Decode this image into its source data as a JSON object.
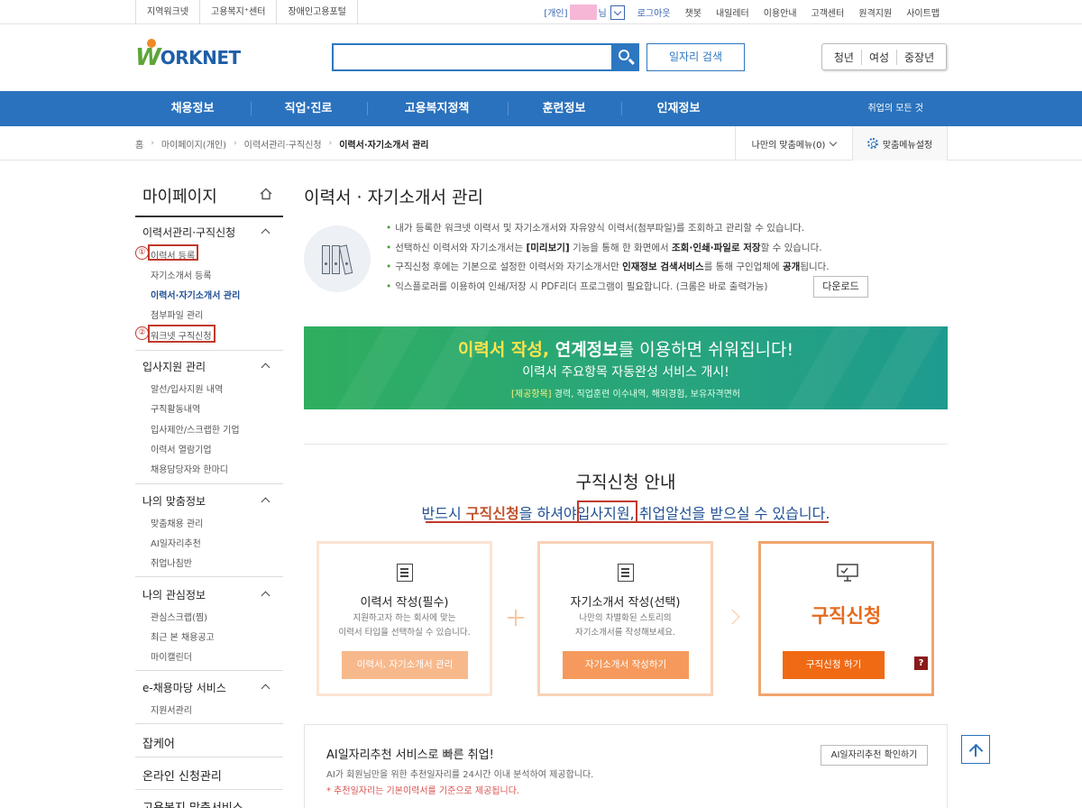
{
  "util": {
    "left_links": [
      "지역워크넷",
      "고용복지⁺센터",
      "장애인고용포털"
    ],
    "user_prefix": "[개인]",
    "user_suffix": "님",
    "right_links": [
      "로그아웃",
      "챗봇",
      "내일레터",
      "이용안내",
      "고객센터",
      "원격지원",
      "사이트맵"
    ]
  },
  "header": {
    "logo_w": "W",
    "logo_rest": "ORKNET",
    "search_placeholder": "",
    "job_search_label": "일자리 검색",
    "target_links": [
      "청년",
      "여성",
      "중장년"
    ]
  },
  "gnb": {
    "items": [
      "채용정보",
      "직업·진로",
      "고용복지정책",
      "훈련정보",
      "인재정보"
    ],
    "right_text": "취업의 모든 것"
  },
  "breadcrumb": {
    "items": [
      "홈",
      "마이페이지(개인)",
      "이력서관리·구직신청",
      "이력서·자기소개서 관리"
    ],
    "my_menu": "나만의 맞춤메뉴(0)",
    "my_setting": "맞춤메뉴설정"
  },
  "sidebar": {
    "title": "마이페이지",
    "sections": [
      {
        "label": "이력서관리·구직신청",
        "items": [
          "이력서 등록",
          "자기소개서 등록",
          "이력서·자기소개서 관리",
          "첨부파일 관리",
          "워크넷 구직신청"
        ]
      },
      {
        "label": "입사지원 관리",
        "items": [
          "알선/입사지원 내역",
          "구직활동내역",
          "입사제안/스크랩한 기업",
          "이력서 열람기업",
          "채용담당자와 한마디"
        ]
      },
      {
        "label": "나의 맞춤정보",
        "items": [
          "맞춤채용 관리",
          "AI일자리추천",
          "취업나침반"
        ]
      },
      {
        "label": "나의 관심정보",
        "items": [
          "관심스크랩(찜)",
          "최근 본 채용공고",
          "마이캘린더"
        ]
      },
      {
        "label": "e-채용마당 서비스",
        "items": [
          "지원서관리"
        ]
      }
    ],
    "extra": [
      "잡케어",
      "온라인 신청관리",
      "고용복지 맞춤서비스"
    ],
    "markers": [
      "①",
      "②"
    ]
  },
  "main": {
    "title": "이력서 · 자기소개서 관리",
    "info": [
      "내가 등록한 워크넷 이력서 및 자기소개서와 자유양식 이력서(첨부파일)를 조회하고 관리할 수 있습니다.",
      {
        "a": "선택하신 이력서와 자기소개서는 ",
        "b": "[미리보기]",
        "c": " 기능을 통해 한 화면에서 ",
        "d": "조회·인쇄·파일로 저장",
        "e": "할 수 있습니다."
      },
      {
        "a": "구직신청 후에는 기본으로 설정한 이력서와 자기소개서만 ",
        "b": "인재정보 검색서비스",
        "c": "를 통해 구인업체에 ",
        "d": "공개",
        "e": "됩니다."
      },
      "익스플로러를 이용하여 인쇄/저장 시 PDF리더 프로그램이 필요합니다. (크롬은 바로 출력가능)"
    ],
    "download_label": "다운로드",
    "banner": {
      "l1_yellow": "이력서 작성,",
      "l1_white_bold": " 연계정보",
      "l1_rest": "를 이용하면 쉬워집니다!",
      "l2": "이력서 주요항목 자동완성 서비스 개시!",
      "l3_tag": "[제공항목]",
      "l3_rest": " 경력, 직업훈련 이수내역, 해외경험, 보유자격면허"
    },
    "guide": {
      "title": "구직신청 안내",
      "sub_a": "반드시 ",
      "sub_b": "구직신청",
      "sub_c": "을 하셔야",
      "sub_d": "입사지원",
      "sub_e": ", 취업알선을 받으실 수 있습니다."
    },
    "cards": [
      {
        "title": "이력서 작성(필수)",
        "desc1": "지원하고자 하는 회사에 맞는",
        "desc2": "이력서 타입을 선택하실 수 있습니다.",
        "button": "이력서, 자기소개서 관리"
      },
      {
        "title": "자기소개서 작성(선택)",
        "desc1": "나만의 차별화된 스토리의",
        "desc2": "자기소개서를 작성해보세요.",
        "button": "자기소개서 작성하기"
      },
      {
        "title": "구직신청",
        "button": "구직신청 하기",
        "help": "?"
      }
    ],
    "ai": {
      "title": "AI일자리추천 서비스로 빠른 취업!",
      "desc": "AI가 회원님만을 위한 추천일자리를 24시간 이내 분석하여 제공합니다.",
      "note": "* 추천일자리는 기본이력서를 기준으로 제공됩니다.",
      "button": "AI일자리추천 확인하기"
    }
  },
  "colors": {
    "primary": "#2a72bd",
    "accent_orange": "#f06a14",
    "banner_green": "#2fae5f",
    "highlight_red": "#c0392b"
  }
}
